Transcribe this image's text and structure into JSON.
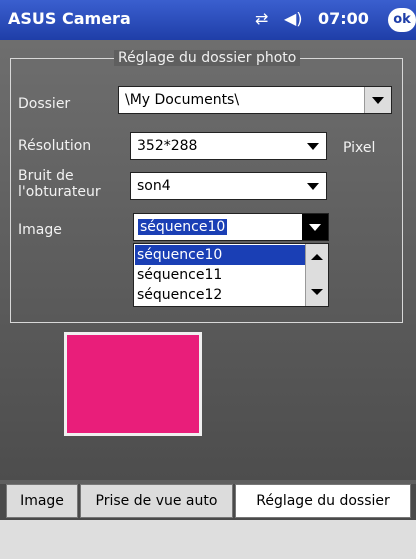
{
  "app": {
    "title": "ASUS Camera",
    "time": "07:00",
    "ok_label": "ok"
  },
  "group": {
    "title": "Réglage du dossier photo",
    "folder_label": "Dossier",
    "folder_value": "\\My Documents\\",
    "resolution_label": "Résolution",
    "resolution_value": "352*288",
    "resolution_unit": "Pixel",
    "shutter_label_line1": "Bruit de",
    "shutter_label_line2": "l'obturateur",
    "shutter_value": "son4",
    "image_label": "Image",
    "image_value": "séquence10",
    "image_options": [
      "séquence10",
      "séquence11",
      "séquence12"
    ]
  },
  "tabs": [
    {
      "label": "Image"
    },
    {
      "label": "Prise de vue auto"
    },
    {
      "label": "Réglage du dossier"
    }
  ],
  "colors": {
    "preview": "#e91e7a",
    "titlebar": "#2a4bbd",
    "selection": "#1a3fb5"
  },
  "icons": [
    "connectivity-icon",
    "volume-icon"
  ]
}
